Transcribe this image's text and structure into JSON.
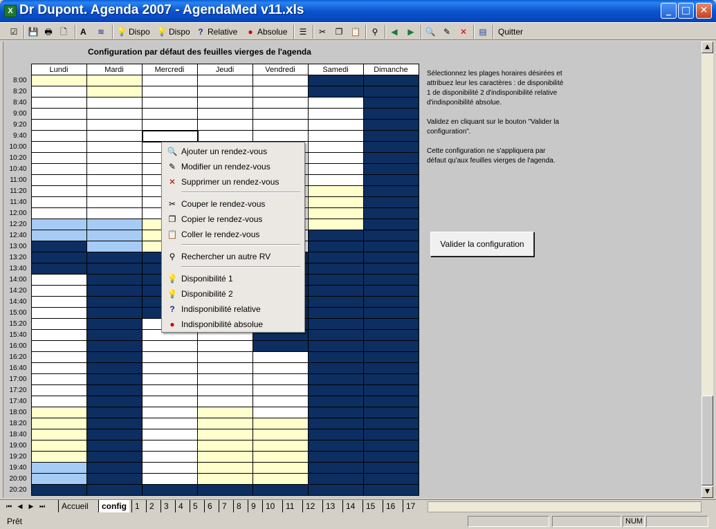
{
  "window": {
    "title": "Dr Dupont. Agenda 2007 - AgendaMed v11.xls",
    "app_icon": "X",
    "min_glyph": "_",
    "max_glyph": "□",
    "close_glyph": "✕"
  },
  "toolbar": {
    "dispo1_label": "Dispo",
    "dispo2_label": "Dispo",
    "relative_label": "Relative",
    "absolue_label": "Absolue",
    "quit_label": "Quitter",
    "font_glyph": "A"
  },
  "sheet": {
    "title": "Configuration par défaut des feuilles vierges de l'agenda",
    "days": [
      "Lundi",
      "Mardi",
      "Mercredi",
      "Jeudi",
      "Vendredi",
      "Samedi",
      "Dimanche"
    ],
    "rows": [
      {
        "time": "8:00",
        "cells": [
          "d2",
          "d2",
          "d1",
          "d1",
          "d1",
          "ia",
          "ia"
        ]
      },
      {
        "time": "8:20",
        "cells": [
          "d1",
          "d2",
          "d1",
          "d1",
          "d1",
          "ia",
          "ia"
        ]
      },
      {
        "time": "8:40",
        "cells": [
          "d1",
          "d1",
          "d1",
          "d1",
          "d1",
          "d1",
          "ia"
        ]
      },
      {
        "time": "9:00",
        "cells": [
          "d1",
          "d1",
          "d1",
          "d1",
          "d1",
          "d1",
          "ia"
        ]
      },
      {
        "time": "9:20",
        "cells": [
          "d1",
          "d1",
          "d1",
          "d1",
          "d1",
          "d1",
          "ia"
        ]
      },
      {
        "time": "9:40",
        "cells": [
          "d1",
          "d1",
          "d1",
          "d1",
          "d1",
          "d1",
          "ia"
        ]
      },
      {
        "time": "10:00",
        "cells": [
          "d1",
          "d1",
          "d1",
          "d1",
          "d1",
          "d1",
          "ia"
        ]
      },
      {
        "time": "10:20",
        "cells": [
          "d1",
          "d1",
          "d1",
          "d1",
          "d1",
          "d1",
          "ia"
        ]
      },
      {
        "time": "10:40",
        "cells": [
          "d1",
          "d1",
          "d1",
          "d1",
          "d1",
          "d1",
          "ia"
        ]
      },
      {
        "time": "11:00",
        "cells": [
          "d1",
          "d1",
          "d1",
          "d1",
          "d1",
          "d1",
          "ia"
        ]
      },
      {
        "time": "11:20",
        "cells": [
          "d1",
          "d1",
          "d1",
          "d1",
          "d1",
          "d2",
          "ia"
        ]
      },
      {
        "time": "11:40",
        "cells": [
          "d1",
          "d1",
          "d1",
          "d1",
          "d1",
          "d2",
          "ia"
        ]
      },
      {
        "time": "12:00",
        "cells": [
          "d1",
          "d1",
          "d1",
          "d1",
          "d1",
          "d2",
          "ia"
        ]
      },
      {
        "time": "12:20",
        "cells": [
          "ir",
          "ir",
          "d2",
          "d1",
          "d1",
          "d2",
          "ia"
        ]
      },
      {
        "time": "12:40",
        "cells": [
          "ir",
          "ir",
          "d2",
          "d1",
          "d1",
          "ia",
          "ia"
        ]
      },
      {
        "time": "13:00",
        "cells": [
          "ia",
          "ir",
          "d2",
          "d1",
          "d1",
          "ia",
          "ia"
        ]
      },
      {
        "time": "13:20",
        "cells": [
          "ia",
          "ia",
          "ia",
          "ia",
          "ia",
          "ia",
          "ia"
        ]
      },
      {
        "time": "13:40",
        "cells": [
          "ia",
          "ia",
          "ia",
          "ia",
          "ia",
          "ia",
          "ia"
        ]
      },
      {
        "time": "14:00",
        "cells": [
          "d1",
          "ia",
          "ia",
          "ia",
          "ia",
          "ia",
          "ia"
        ]
      },
      {
        "time": "14:20",
        "cells": [
          "d1",
          "ia",
          "ia",
          "ia",
          "ia",
          "ia",
          "ia"
        ]
      },
      {
        "time": "14:40",
        "cells": [
          "d1",
          "ia",
          "ia",
          "ia",
          "ia",
          "ia",
          "ia"
        ]
      },
      {
        "time": "15:00",
        "cells": [
          "d1",
          "ia",
          "ia",
          "ia",
          "ia",
          "ia",
          "ia"
        ]
      },
      {
        "time": "15:20",
        "cells": [
          "d1",
          "ia",
          "d1",
          "d1",
          "ia",
          "ia",
          "ia"
        ]
      },
      {
        "time": "15:40",
        "cells": [
          "d1",
          "ia",
          "d1",
          "d1",
          "ia",
          "ia",
          "ia"
        ]
      },
      {
        "time": "16:00",
        "cells": [
          "d1",
          "ia",
          "d1",
          "d1",
          "ia",
          "ia",
          "ia"
        ]
      },
      {
        "time": "16:20",
        "cells": [
          "d1",
          "ia",
          "d1",
          "d1",
          "d1",
          "ia",
          "ia"
        ]
      },
      {
        "time": "16:40",
        "cells": [
          "d1",
          "ia",
          "d1",
          "d1",
          "d1",
          "ia",
          "ia"
        ]
      },
      {
        "time": "17:00",
        "cells": [
          "d1",
          "ia",
          "d1",
          "d1",
          "d1",
          "ia",
          "ia"
        ]
      },
      {
        "time": "17:20",
        "cells": [
          "d1",
          "ia",
          "d1",
          "d1",
          "d1",
          "ia",
          "ia"
        ]
      },
      {
        "time": "17:40",
        "cells": [
          "d1",
          "ia",
          "d1",
          "d1",
          "d1",
          "ia",
          "ia"
        ]
      },
      {
        "time": "18:00",
        "cells": [
          "d2",
          "ia",
          "d1",
          "d2",
          "d1",
          "ia",
          "ia"
        ]
      },
      {
        "time": "18:20",
        "cells": [
          "d2",
          "ia",
          "d1",
          "d2",
          "d2",
          "ia",
          "ia"
        ]
      },
      {
        "time": "18:40",
        "cells": [
          "d2",
          "ia",
          "d1",
          "d2",
          "d2",
          "ia",
          "ia"
        ]
      },
      {
        "time": "19:00",
        "cells": [
          "d2",
          "ia",
          "d1",
          "d2",
          "d2",
          "ia",
          "ia"
        ]
      },
      {
        "time": "19:20",
        "cells": [
          "d2",
          "ia",
          "d1",
          "d2",
          "d2",
          "ia",
          "ia"
        ]
      },
      {
        "time": "19:40",
        "cells": [
          "ir",
          "ia",
          "d1",
          "d2",
          "d2",
          "ia",
          "ia"
        ]
      },
      {
        "time": "20:00",
        "cells": [
          "ir",
          "ia",
          "d1",
          "d2",
          "d2",
          "ia",
          "ia"
        ]
      },
      {
        "time": "20:20",
        "cells": [
          "ia",
          "ia",
          "ia",
          "ia",
          "ia",
          "ia",
          "ia"
        ]
      }
    ],
    "instructions": [
      "Sélectionnez les plages horaires désirées et attribuez leur les caractères : de disponibilité 1 de disponibilité 2 d'indisponibilité relative d'indisponibilité absolue.",
      "Validez en cliquant sur le bouton \"Valider la configuration\".",
      "Cette configuration ne s'appliquera par défaut qu'aux feuilles vierges de l'agenda."
    ],
    "validate_button": "Valider la configuration"
  },
  "context_menu": {
    "items": [
      {
        "label": "Ajouter un rendez-vous",
        "icon": "🔍"
      },
      {
        "label": "Modifier un rendez-vous",
        "icon": "✎"
      },
      {
        "label": "Supprimer un rendez-vous",
        "icon": "✕"
      },
      {
        "label": "Couper le rendez-vous",
        "icon": "✂"
      },
      {
        "label": "Copier le rendez-vous",
        "icon": "❐"
      },
      {
        "label": "Coller le rendez-vous",
        "icon": "📋"
      },
      {
        "label": "Rechercher un autre RV",
        "icon": "⚲"
      },
      {
        "label": "Disponibilité 1",
        "icon": "💡"
      },
      {
        "label": "Disponibilité 2",
        "icon": "💡"
      },
      {
        "label": "Indisponibilité relative",
        "icon": "?"
      },
      {
        "label": "Indisponibilité absolue",
        "icon": "●"
      }
    ]
  },
  "tabs": {
    "items": [
      "Accueil",
      "config",
      "1",
      "2",
      "3",
      "4",
      "5",
      "6",
      "7",
      "8",
      "9",
      "10",
      "11",
      "12",
      "13",
      "14",
      "15",
      "16",
      "17"
    ],
    "active": "config"
  },
  "status": {
    "text": "Prêt",
    "num": "NUM"
  },
  "colors": {
    "dispo1": "#ffffff",
    "dispo2": "#ffffcc",
    "indispo_relative": "#a6cbf5",
    "indispo_absolue": "#0d2e60"
  }
}
